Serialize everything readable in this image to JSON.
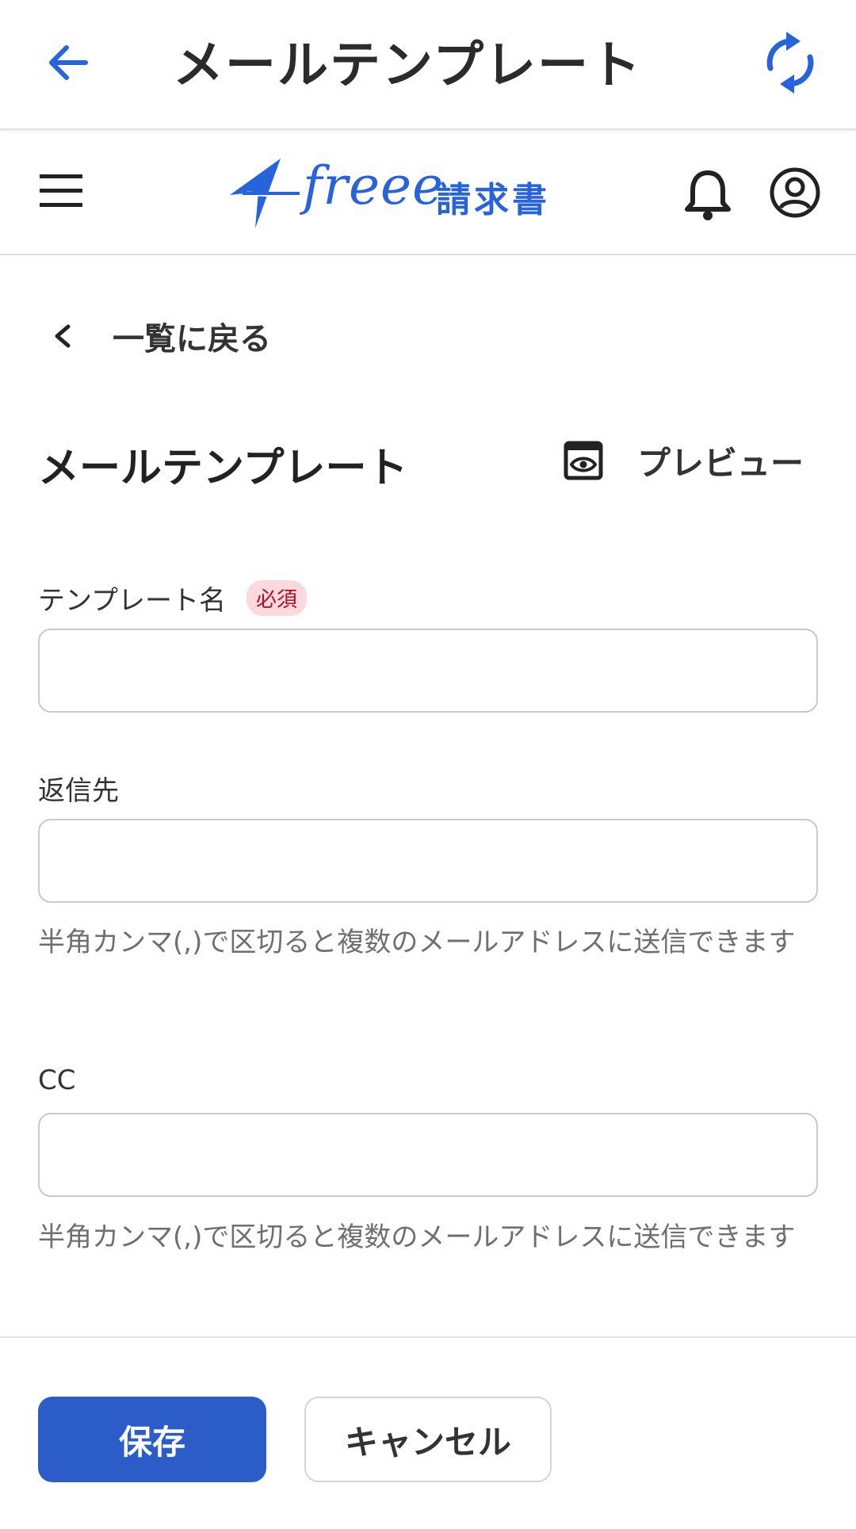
{
  "appbar": {
    "title": "メールテンプレート"
  },
  "header": {
    "logo_text": "freee",
    "logo_product": "請求書"
  },
  "nav": {
    "back_link": "一覧に戻る"
  },
  "section": {
    "title": "メールテンプレート",
    "preview_label": "プレビュー"
  },
  "form": {
    "template_name": {
      "label": "テンプレート名",
      "required_badge": "必須",
      "value": ""
    },
    "reply_to": {
      "label": "返信先",
      "value": "",
      "help": "半角カンマ(,)で区切ると複数のメールアドレスに送信できます"
    },
    "cc": {
      "label": "CC",
      "value": "",
      "help": "半角カンマ(,)で区切ると複数のメールアドレスに送信できます"
    }
  },
  "actions": {
    "save_label": "保存",
    "cancel_label": "キャンセル"
  },
  "colors": {
    "brand": "#2764dc",
    "primary_button": "#2b5cc8",
    "required_badge_bg": "#fbd9dd",
    "required_badge_text": "#b0102e"
  },
  "icons": [
    "arrow-back-icon",
    "refresh-icon",
    "menu-icon",
    "freee-bird-logo",
    "bell-icon",
    "account-icon",
    "chevron-left-icon",
    "preview-eye-icon"
  ]
}
